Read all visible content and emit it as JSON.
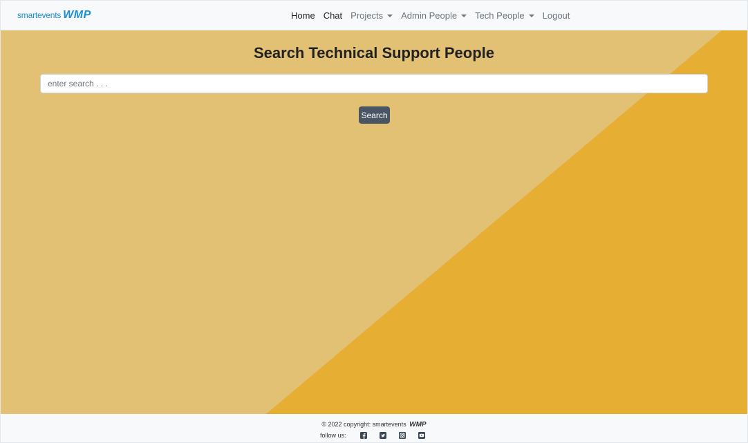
{
  "navbar": {
    "brand_small": "smartevents",
    "brand_logo": "WMP",
    "links": [
      {
        "label": "Home",
        "dropdown": false
      },
      {
        "label": "Chat",
        "dropdown": false
      },
      {
        "label": "Projects",
        "dropdown": true
      },
      {
        "label": "Admin People",
        "dropdown": true
      },
      {
        "label": "Tech People",
        "dropdown": true
      },
      {
        "label": "Logout",
        "dropdown": false
      }
    ]
  },
  "main": {
    "title": "Search Technical Support People",
    "search_placeholder": "enter search . . .",
    "search_value": "",
    "search_button": "Search"
  },
  "footer": {
    "copyright_text": "© 2022 copyright: smartevents",
    "copyright_logo": "WMP",
    "follow_label": "follow us:",
    "social_icons": [
      "facebook-icon",
      "twitter-icon",
      "instagram-icon",
      "youtube-icon"
    ]
  },
  "colors": {
    "brand": "#1a8fd1",
    "background_light": "#e2c074",
    "background_dark": "#e6ae33",
    "button": "#4a5563",
    "navbar": "#f8f9fa"
  }
}
